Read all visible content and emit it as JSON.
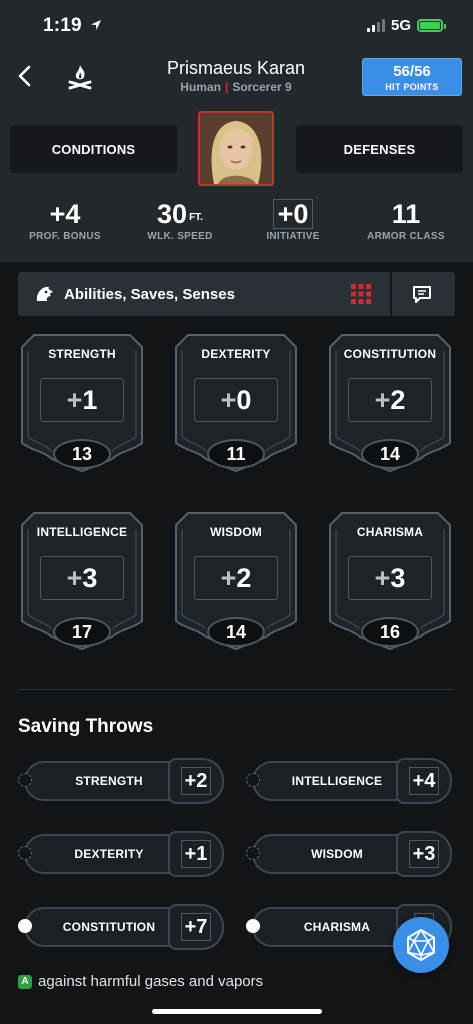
{
  "status_bar": {
    "time": "1:19",
    "network": "5G"
  },
  "header": {
    "name": "Prismaeus Karan",
    "race": "Human",
    "class_level": "Sorcerer 9",
    "hit_points": {
      "current_max": "56/56",
      "label": "HIT POINTS"
    }
  },
  "buttons": {
    "conditions": "CONDITIONS",
    "defenses": "DEFENSES"
  },
  "stats": {
    "prof_bonus": {
      "value": "+4",
      "label": "PROF. BONUS"
    },
    "walk_speed": {
      "value": "30",
      "unit": "FT.",
      "label": "WLK. SPEED"
    },
    "initiative": {
      "value": "+0",
      "label": "INITIATIVE"
    },
    "armor_class": {
      "value": "11",
      "label": "ARMOR CLASS"
    }
  },
  "section": {
    "title": "Abilities, Saves, Senses"
  },
  "abilities": [
    {
      "name": "STRENGTH",
      "sign": "+",
      "mod": "1",
      "score": "13"
    },
    {
      "name": "DEXTERITY",
      "sign": "+",
      "mod": "0",
      "score": "11"
    },
    {
      "name": "CONSTITUTION",
      "sign": "+",
      "mod": "2",
      "score": "14"
    },
    {
      "name": "INTELLIGENCE",
      "sign": "+",
      "mod": "3",
      "score": "17"
    },
    {
      "name": "WISDOM",
      "sign": "+",
      "mod": "2",
      "score": "14"
    },
    {
      "name": "CHARISMA",
      "sign": "+",
      "mod": "3",
      "score": "16"
    }
  ],
  "saving_throws": {
    "title": "Saving Throws",
    "items": [
      {
        "name": "STRENGTH",
        "bonus": "+2"
      },
      {
        "name": "INTELLIGENCE",
        "bonus": "+4"
      },
      {
        "name": "DEXTERITY",
        "bonus": "+1"
      },
      {
        "name": "WISDOM",
        "bonus": "+3"
      },
      {
        "name": "CONSTITUTION",
        "bonus": "+7"
      },
      {
        "name": "CHARISMA",
        "bonus": "+"
      }
    ],
    "proficient": [
      "CONSTITUTION",
      "CHARISMA"
    ]
  },
  "advantage_note": {
    "badge": "A",
    "text": "against harmful gases and vapors"
  },
  "colors": {
    "accent": "#3a8ee6",
    "header_bg": "#23282d",
    "page_bg": "#121518",
    "red": "#c53131",
    "battery": "#3ecf54"
  }
}
